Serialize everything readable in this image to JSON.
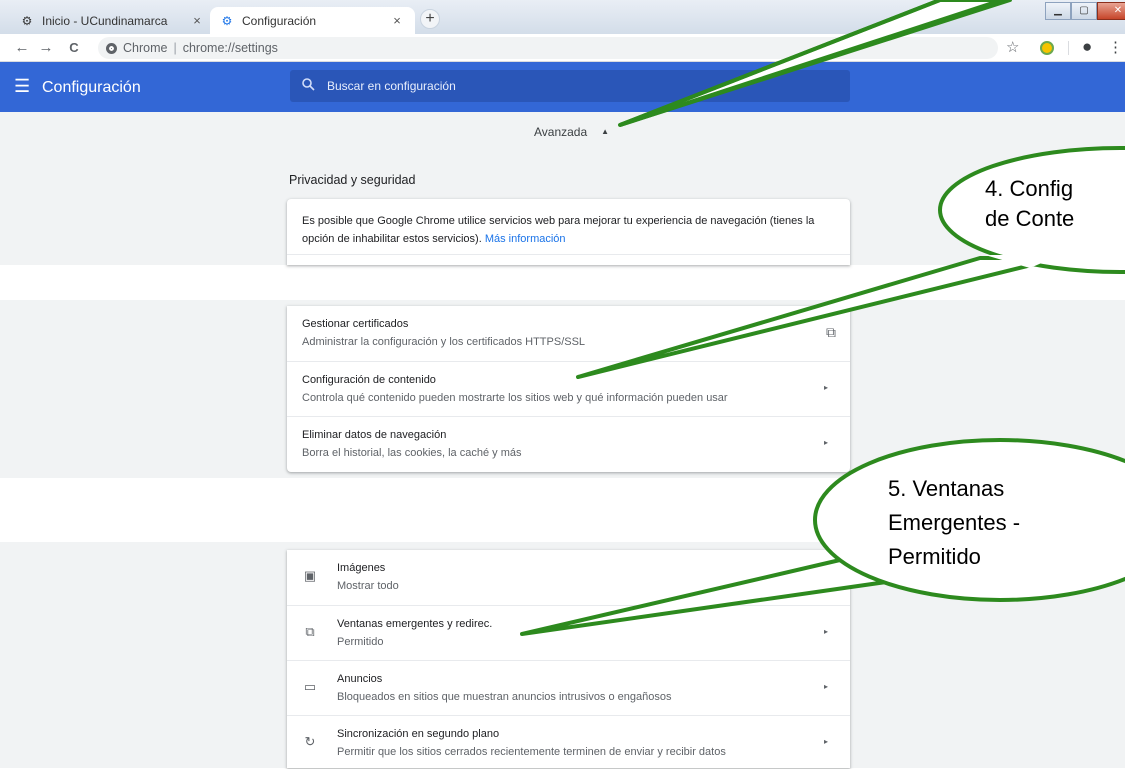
{
  "tabs": [
    {
      "label": "Inicio - UCundinamarca",
      "icon": "settings-gear-icon",
      "close": "×"
    },
    {
      "label": "Configuración",
      "icon": "settings-gear-icon",
      "close": "×"
    }
  ],
  "new_tab": "+",
  "toolbar": {
    "back": "←",
    "forward": "→",
    "reload": "C",
    "site_label": "Chrome",
    "separator": "|",
    "url": "chrome://settings",
    "star": "☆",
    "profile": "●",
    "menu": "⋮"
  },
  "settings_header": {
    "title": "Configuración",
    "search_placeholder": "Buscar en configuración"
  },
  "advanced": {
    "label": "Avanzada",
    "arrow": "▲"
  },
  "privacy": {
    "heading": "Privacidad y seguridad",
    "intro": "Es posible que Google Chrome utilice servicios web para mejorar tu experiencia de navegación (tienes la opción de inhabilitar estos servicios).",
    "link": "Más información"
  },
  "privacy_rows": [
    {
      "title": "Gestionar certificados",
      "subtitle": "Administrar la configuración y los certificados HTTPS/SSL",
      "trail": "⧉"
    },
    {
      "title": "Configuración de contenido",
      "subtitle": "Controla qué contenido pueden mostrarte los sitios web y qué información pueden usar",
      "trail": "▸"
    },
    {
      "title": "Eliminar datos de navegación",
      "subtitle": "Borra el historial, las cookies, la caché y más",
      "trail": "▸"
    }
  ],
  "content_rows": [
    {
      "icon": "image-icon",
      "glyph": "▣",
      "title": "Imágenes",
      "subtitle": "Mostrar todo",
      "trail": "▸"
    },
    {
      "icon": "open-in-new-icon",
      "glyph": "⧉",
      "title": "Ventanas emergentes y redirec.",
      "subtitle": "Permitido",
      "trail": "▸"
    },
    {
      "icon": "ads-icon",
      "glyph": "▭",
      "title": "Anuncios",
      "subtitle": "Bloqueados en sitios que muestran anuncios intrusivos o engañosos",
      "trail": "▸"
    },
    {
      "icon": "sync-icon",
      "glyph": "↻",
      "title": "Sincronización en segundo plano",
      "subtitle": "Permitir que los sitios cerrados recientemente terminen de enviar y recibir datos",
      "trail": "▸"
    }
  ],
  "callouts": {
    "four_line1": "4. Config",
    "four_line2": "de Conte",
    "five_line1": "5. Ventanas",
    "five_line2": "Emergentes -",
    "five_line3": "Permitido"
  },
  "colors": {
    "header_blue": "#3367d6",
    "callout_green": "#2d8a1e",
    "link_blue": "#1a73e8"
  }
}
